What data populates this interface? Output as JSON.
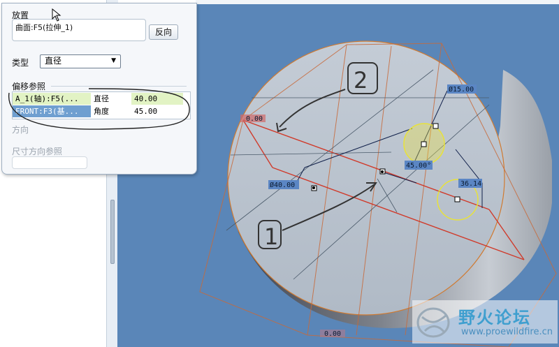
{
  "panel": {
    "placement_label": "放置",
    "placement_value": "曲面:F5(拉伸_1)",
    "flip_button": "反向",
    "type_label": "类型",
    "type_value": "直径",
    "offset_refs_label": "偏移参照",
    "refs": [
      {
        "ref": "A_1(轴):F5(...",
        "kind": "直径",
        "value": "40.00"
      },
      {
        "ref": "FRONT:F3(基...",
        "kind": "角度",
        "value": "45.00"
      }
    ],
    "direction_label": "方向",
    "dim_dir_ref_label": "尺寸方向参照"
  },
  "viewport": {
    "dims": {
      "d_top": "Ø15.00",
      "d_left": "Ø40.00",
      "angle": "45.00°",
      "d_right": "36.14",
      "tag_a": "0.00",
      "tag_b": "0.00"
    },
    "annotations": {
      "one": "1",
      "two": "2"
    }
  },
  "watermark": {
    "title": "野火论坛",
    "url": "www.proewildfire.cn"
  },
  "colors": {
    "viewport_bg": "#5a86b8",
    "dim_label_bg": "#5b86c4",
    "highlight": "#e8e23a",
    "edge_orange": "#d07a30",
    "edge_red": "#d03a2a"
  }
}
